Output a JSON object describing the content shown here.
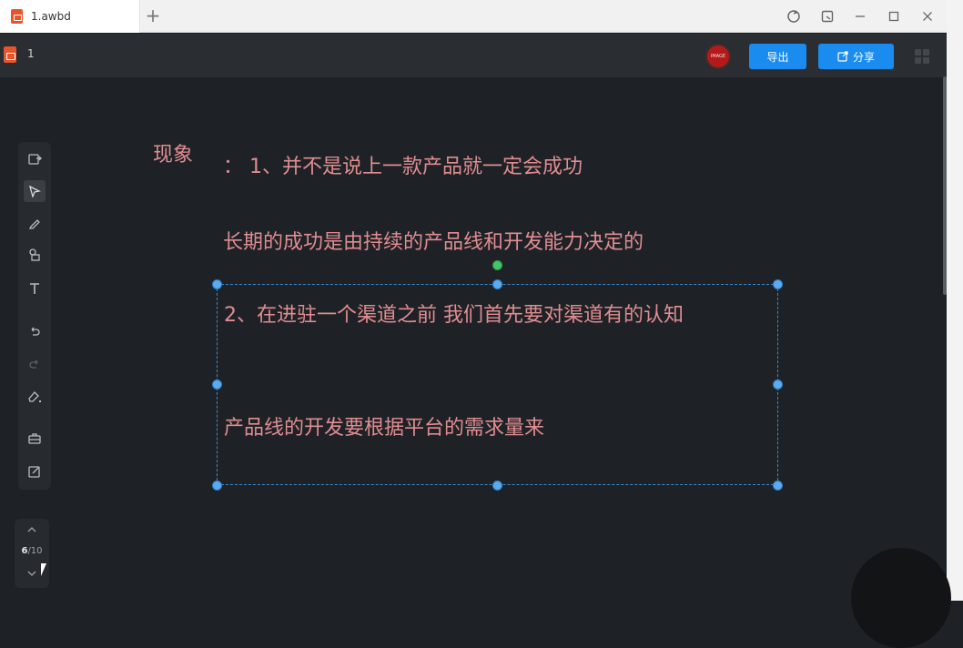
{
  "window": {
    "tab_title": "1.awbd",
    "new_tab_symbol": "+"
  },
  "app": {
    "doc_name": "1",
    "avatar_text": "IMAGE",
    "export_label": "导出",
    "share_label": "分享",
    "accent_color": "#1a8cf0"
  },
  "toolbar": {
    "tools": [
      "insert-icon",
      "select-icon",
      "pen-icon",
      "shapes-icon",
      "text-icon",
      "undo-icon",
      "redo-icon",
      "eraser-icon",
      "toolbox-icon",
      "edit-icon"
    ],
    "selected_tool": "select-icon"
  },
  "pager": {
    "current": "6",
    "total": "/10"
  },
  "slide": {
    "text_color": "#e08d91",
    "label": "现象",
    "line1": "：  1、并不是说上一款产品就一定会成功",
    "line2": "长期的成功是由持续的产品线和开发能力决定的",
    "line3": "2、在进驻一个渠道之前 我们首先要对渠道有的认知",
    "line4": "产品线的开发要根据平台的需求量来"
  }
}
